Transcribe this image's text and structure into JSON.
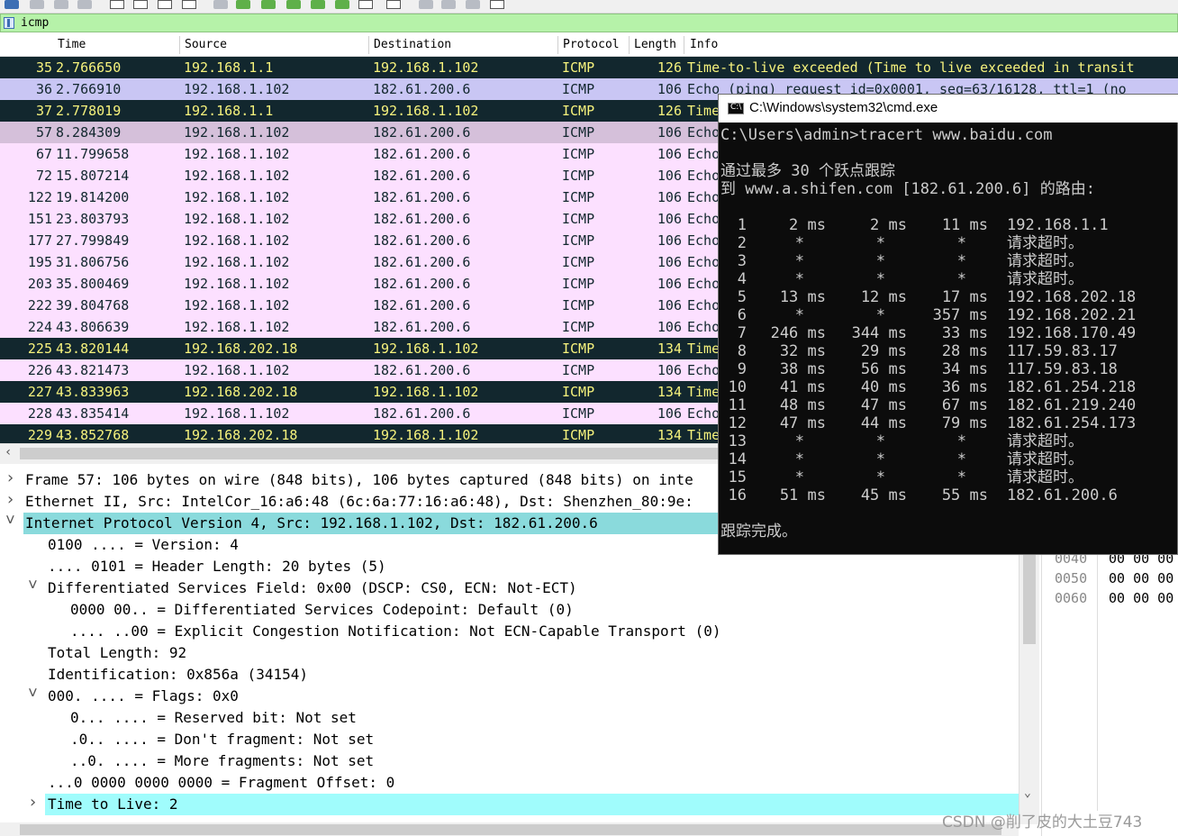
{
  "toolbar": {
    "icons": [
      "shark-fin-start-icon",
      "stop-icon",
      "restart-icon",
      "options-gear-icon",
      "open-folder-icon",
      "save-icon",
      "close-file-icon",
      "reload-icon",
      "find-icon",
      "back-icon",
      "forward-icon",
      "goto-icon",
      "first-icon",
      "last-icon",
      "autoscroll-icon",
      "colorize-icon",
      "zoom-in-icon",
      "zoom-out-icon",
      "zoom-normal-icon",
      "resize-columns-icon"
    ]
  },
  "filter": {
    "value": "icmp"
  },
  "packet_list": {
    "columns": [
      "Time",
      "Source",
      "Destination",
      "Protocol",
      "Length",
      "Info"
    ],
    "rows": [
      {
        "no": "35",
        "time": "2.766650",
        "src": "192.168.1.1",
        "dst": "192.168.1.102",
        "proto": "ICMP",
        "len": "126",
        "info": "Time-to-live exceeded (Time to live exceeded in transit",
        "style": "dark"
      },
      {
        "no": "36",
        "time": "2.766910",
        "src": "192.168.1.102",
        "dst": "182.61.200.6",
        "proto": "ICMP",
        "len": "106",
        "info": "Echo (ping) request  id=0x0001, seq=63/16128, ttl=1 (no",
        "style": "lav"
      },
      {
        "no": "37",
        "time": "2.778019",
        "src": "192.168.1.1",
        "dst": "192.168.1.102",
        "proto": "ICMP",
        "len": "126",
        "info": "Time",
        "style": "dark"
      },
      {
        "no": "57",
        "time": "8.284309",
        "src": "192.168.1.102",
        "dst": "182.61.200.6",
        "proto": "ICMP",
        "len": "106",
        "info": "Echo",
        "style": "sel"
      },
      {
        "no": "67",
        "time": "11.799658",
        "src": "192.168.1.102",
        "dst": "182.61.200.6",
        "proto": "ICMP",
        "len": "106",
        "info": "Echo",
        "style": "pink"
      },
      {
        "no": "72",
        "time": "15.807214",
        "src": "192.168.1.102",
        "dst": "182.61.200.6",
        "proto": "ICMP",
        "len": "106",
        "info": "Echo",
        "style": "pink"
      },
      {
        "no": "122",
        "time": "19.814200",
        "src": "192.168.1.102",
        "dst": "182.61.200.6",
        "proto": "ICMP",
        "len": "106",
        "info": "Echo",
        "style": "pink"
      },
      {
        "no": "151",
        "time": "23.803793",
        "src": "192.168.1.102",
        "dst": "182.61.200.6",
        "proto": "ICMP",
        "len": "106",
        "info": "Echo",
        "style": "pink"
      },
      {
        "no": "177",
        "time": "27.799849",
        "src": "192.168.1.102",
        "dst": "182.61.200.6",
        "proto": "ICMP",
        "len": "106",
        "info": "Echo",
        "style": "pink"
      },
      {
        "no": "195",
        "time": "31.806756",
        "src": "192.168.1.102",
        "dst": "182.61.200.6",
        "proto": "ICMP",
        "len": "106",
        "info": "Echo",
        "style": "pink"
      },
      {
        "no": "203",
        "time": "35.800469",
        "src": "192.168.1.102",
        "dst": "182.61.200.6",
        "proto": "ICMP",
        "len": "106",
        "info": "Echo",
        "style": "pink"
      },
      {
        "no": "222",
        "time": "39.804768",
        "src": "192.168.1.102",
        "dst": "182.61.200.6",
        "proto": "ICMP",
        "len": "106",
        "info": "Echo",
        "style": "pink"
      },
      {
        "no": "224",
        "time": "43.806639",
        "src": "192.168.1.102",
        "dst": "182.61.200.6",
        "proto": "ICMP",
        "len": "106",
        "info": "Echo",
        "style": "pink"
      },
      {
        "no": "225",
        "time": "43.820144",
        "src": "192.168.202.18",
        "dst": "192.168.1.102",
        "proto": "ICMP",
        "len": "134",
        "info": "Time",
        "style": "dark"
      },
      {
        "no": "226",
        "time": "43.821473",
        "src": "192.168.1.102",
        "dst": "182.61.200.6",
        "proto": "ICMP",
        "len": "106",
        "info": "Echo",
        "style": "pink"
      },
      {
        "no": "227",
        "time": "43.833963",
        "src": "192.168.202.18",
        "dst": "192.168.1.102",
        "proto": "ICMP",
        "len": "134",
        "info": "Time",
        "style": "dark"
      },
      {
        "no": "228",
        "time": "43.835414",
        "src": "192.168.1.102",
        "dst": "182.61.200.6",
        "proto": "ICMP",
        "len": "106",
        "info": "Echo",
        "style": "pink"
      },
      {
        "no": "229",
        "time": "43.852768",
        "src": "192.168.202.18",
        "dst": "192.168.1.102",
        "proto": "ICMP",
        "len": "134",
        "info": "Time",
        "style": "dark"
      }
    ],
    "row_colors": {
      "dark_bg": "#12272e",
      "dark_fg": "#f7f37d",
      "lav_bg": "#c9c6f4",
      "pink_bg": "#fce0ff",
      "sel_bg": "#d5c0da"
    }
  },
  "details": {
    "rows": [
      {
        "text": "Frame 57: 106 bytes on wire (848 bits), 106 bytes captured (848 bits) on inte",
        "indent": 0,
        "arrow": "collapsed"
      },
      {
        "text": "Ethernet II, Src: IntelCor_16:a6:48 (6c:6a:77:16:a6:48), Dst: Shenzhen_80:9e:",
        "indent": 0,
        "arrow": "collapsed"
      },
      {
        "text": "Internet Protocol Version 4, Src: 192.168.1.102, Dst: 182.61.200.6",
        "indent": 0,
        "arrow": "expanded",
        "highlight": "#8adadc"
      },
      {
        "text": "0100 .... = Version: 4",
        "indent": 1,
        "arrow": ""
      },
      {
        "text": ".... 0101 = Header Length: 20 bytes (5)",
        "indent": 1,
        "arrow": ""
      },
      {
        "text": "Differentiated Services Field: 0x00 (DSCP: CS0, ECN: Not-ECT)",
        "indent": 1,
        "arrow": "expanded"
      },
      {
        "text": "0000 00.. = Differentiated Services Codepoint: Default (0)",
        "indent": 2,
        "arrow": ""
      },
      {
        "text": ".... ..00 = Explicit Congestion Notification: Not ECN-Capable Transport (0)",
        "indent": 2,
        "arrow": ""
      },
      {
        "text": "Total Length: 92",
        "indent": 1,
        "arrow": ""
      },
      {
        "text": "Identification: 0x856a (34154)",
        "indent": 1,
        "arrow": ""
      },
      {
        "text": "000. .... = Flags: 0x0",
        "indent": 1,
        "arrow": "expanded"
      },
      {
        "text": "0... .... = Reserved bit: Not set",
        "indent": 2,
        "arrow": ""
      },
      {
        "text": ".0.. .... = Don't fragment: Not set",
        "indent": 2,
        "arrow": ""
      },
      {
        "text": "..0. .... = More fragments: Not set",
        "indent": 2,
        "arrow": ""
      },
      {
        "text": "...0 0000 0000 0000 = Fragment Offset: 0",
        "indent": 1,
        "arrow": ""
      },
      {
        "text": "Time to Live: 2",
        "indent": 1,
        "arrow": "collapsed",
        "highlight": "#a0fcfc"
      }
    ]
  },
  "bytes_pane": {
    "rows": [
      {
        "offset": "0040",
        "hex": "00 00 00"
      },
      {
        "offset": "0050",
        "hex": "00 00 00"
      },
      {
        "offset": "0060",
        "hex": "00 00 00"
      }
    ]
  },
  "cmd": {
    "title": "C:\\Windows\\system32\\cmd.exe",
    "icon_text": "C:\\",
    "command_line": "C:\\Users\\admin>tracert www.baidu.com",
    "header1": "通过最多 30 个跃点跟踪",
    "header2": "到 www.a.shifen.com [182.61.200.6] 的路由:",
    "hops": [
      {
        "n": "1",
        "t1": "2 ms",
        "t2": "2 ms",
        "t3": "11 ms",
        "addr": "192.168.1.1"
      },
      {
        "n": "2",
        "t1": "*",
        "t2": "*",
        "t3": "*",
        "addr": "请求超时。"
      },
      {
        "n": "3",
        "t1": "*",
        "t2": "*",
        "t3": "*",
        "addr": "请求超时。"
      },
      {
        "n": "4",
        "t1": "*",
        "t2": "*",
        "t3": "*",
        "addr": "请求超时。"
      },
      {
        "n": "5",
        "t1": "13 ms",
        "t2": "12 ms",
        "t3": "17 ms",
        "addr": "192.168.202.18"
      },
      {
        "n": "6",
        "t1": "*",
        "t2": "*",
        "t3": "357 ms",
        "addr": "192.168.202.21"
      },
      {
        "n": "7",
        "t1": "246 ms",
        "t2": "344 ms",
        "t3": "33 ms",
        "addr": "192.168.170.49"
      },
      {
        "n": "8",
        "t1": "32 ms",
        "t2": "29 ms",
        "t3": "28 ms",
        "addr": "117.59.83.17"
      },
      {
        "n": "9",
        "t1": "38 ms",
        "t2": "56 ms",
        "t3": "34 ms",
        "addr": "117.59.83.18"
      },
      {
        "n": "10",
        "t1": "41 ms",
        "t2": "40 ms",
        "t3": "36 ms",
        "addr": "182.61.254.218"
      },
      {
        "n": "11",
        "t1": "48 ms",
        "t2": "47 ms",
        "t3": "67 ms",
        "addr": "182.61.219.240"
      },
      {
        "n": "12",
        "t1": "47 ms",
        "t2": "44 ms",
        "t3": "79 ms",
        "addr": "182.61.254.173"
      },
      {
        "n": "13",
        "t1": "*",
        "t2": "*",
        "t3": "*",
        "addr": "请求超时。"
      },
      {
        "n": "14",
        "t1": "*",
        "t2": "*",
        "t3": "*",
        "addr": "请求超时。"
      },
      {
        "n": "15",
        "t1": "*",
        "t2": "*",
        "t3": "*",
        "addr": "请求超时。"
      },
      {
        "n": "16",
        "t1": "51 ms",
        "t2": "45 ms",
        "t3": "55 ms",
        "addr": "182.61.200.6"
      }
    ],
    "done": "跟踪完成。"
  },
  "watermark": "CSDN @削了皮的大土豆743"
}
